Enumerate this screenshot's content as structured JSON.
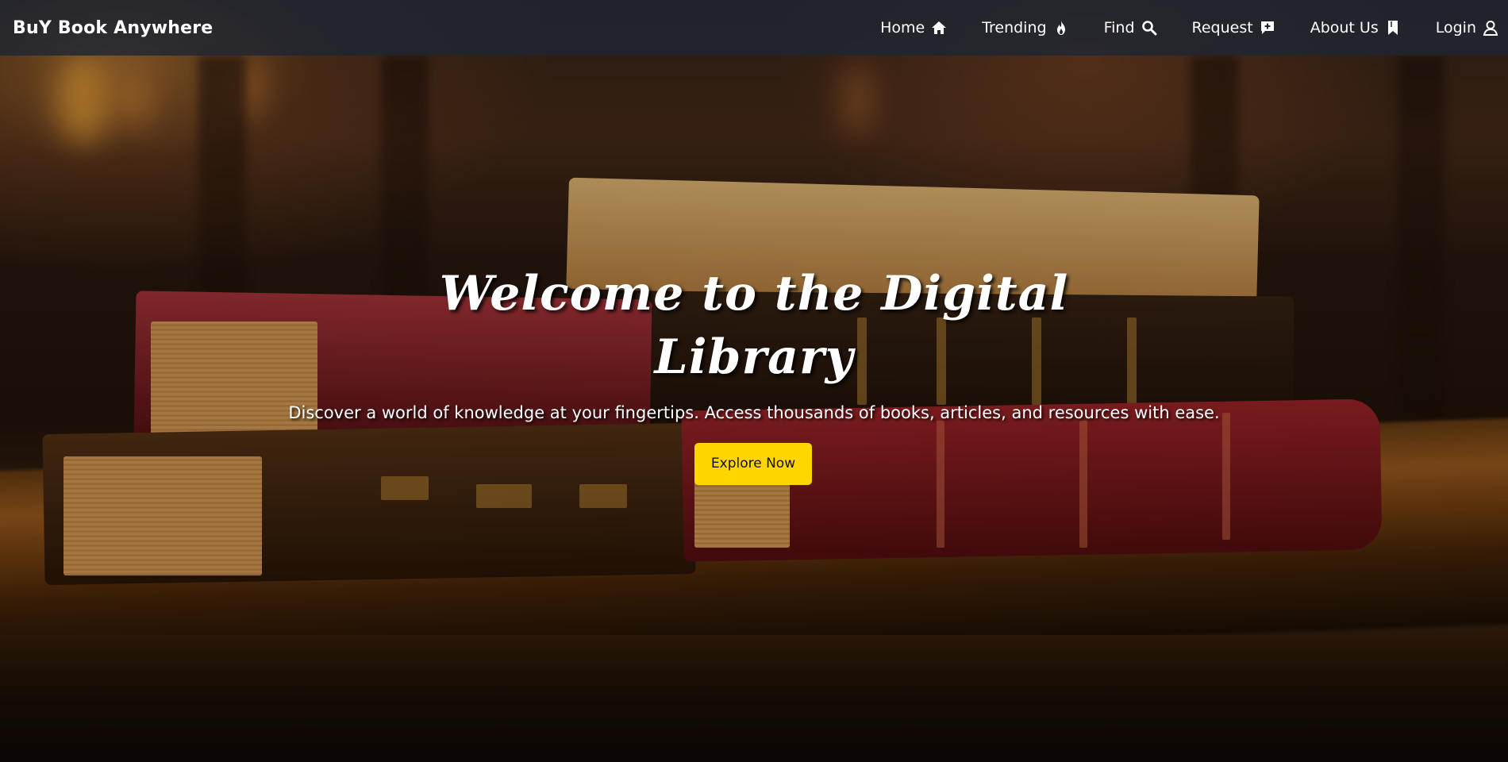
{
  "navbar": {
    "brand": "BuY Book Anywhere",
    "items": [
      {
        "label": "Home",
        "icon": "home-icon"
      },
      {
        "label": "Trending",
        "icon": "fire-icon"
      },
      {
        "label": "Find",
        "icon": "search-icon"
      },
      {
        "label": "Request",
        "icon": "add-message-icon"
      },
      {
        "label": "About Us",
        "icon": "bookmark-icon"
      },
      {
        "label": "Login",
        "icon": "user-icon"
      }
    ]
  },
  "hero": {
    "title": "Welcome to the Digital Library",
    "subtitle": "Discover a world of knowledge at your fingertips. Access thousands of books, articles, and resources with ease.",
    "cta_label": "Explore Now",
    "background_image": "books-on-wooden-table-photo"
  },
  "colors": {
    "navbar_bg": "#1f2632",
    "cta_bg": "#ffd600",
    "cta_text": "#111111",
    "text": "#ffffff"
  }
}
